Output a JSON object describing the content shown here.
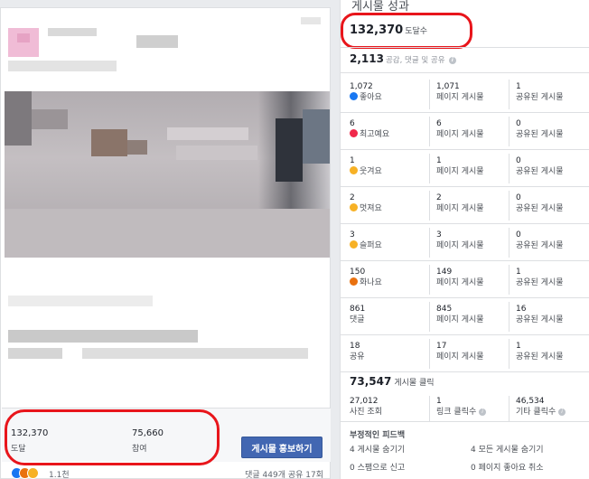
{
  "post": {
    "reach_value": "132,370",
    "reach_label": "도달",
    "engagement_value": "75,660",
    "engagement_label": "참여",
    "promote_button": "게시물 홍보하기",
    "reaction_count": "1.1천",
    "comments_shares": "댓글 449개  공유 17회"
  },
  "panel": {
    "title": "게시물 성과",
    "reach_value": "132,370",
    "reach_label": "도달수",
    "engagement_total": "2,113",
    "engagement_label": "공감, 댓글 및 공유",
    "rows": [
      {
        "icon": "like-emoji-icon",
        "emo": "like",
        "c1v": "1,072",
        "c1l": "좋아요",
        "c2v": "1,071",
        "c2l": "페이지 게시물",
        "c3v": "1",
        "c3l": "공유된 게시물"
      },
      {
        "icon": "love-emoji-icon",
        "emo": "love",
        "c1v": "6",
        "c1l": "최고예요",
        "c2v": "6",
        "c2l": "페이지 게시물",
        "c3v": "0",
        "c3l": "공유된 게시물"
      },
      {
        "icon": "haha-emoji-icon",
        "emo": "haha",
        "c1v": "1",
        "c1l": "웃겨요",
        "c2v": "1",
        "c2l": "페이지 게시물",
        "c3v": "0",
        "c3l": "공유된 게시물"
      },
      {
        "icon": "wow-emoji-icon",
        "emo": "wow",
        "c1v": "2",
        "c1l": "멋져요",
        "c2v": "2",
        "c2l": "페이지 게시물",
        "c3v": "0",
        "c3l": "공유된 게시물"
      },
      {
        "icon": "sad-emoji-icon",
        "emo": "sad",
        "c1v": "3",
        "c1l": "슬퍼요",
        "c2v": "3",
        "c2l": "페이지 게시물",
        "c3v": "0",
        "c3l": "공유된 게시물"
      },
      {
        "icon": "angry-emoji-icon",
        "emo": "angry",
        "c1v": "150",
        "c1l": "화나요",
        "c2v": "149",
        "c2l": "페이지 게시물",
        "c3v": "1",
        "c3l": "공유된 게시물"
      },
      {
        "icon": "",
        "emo": "",
        "c1v": "861",
        "c1l": "댓글",
        "c2v": "845",
        "c2l": "페이지 게시물",
        "c3v": "16",
        "c3l": "공유된 게시물"
      },
      {
        "icon": "",
        "emo": "",
        "c1v": "18",
        "c1l": "공유",
        "c2v": "17",
        "c2l": "페이지 게시물",
        "c3v": "1",
        "c3l": "공유된 게시물"
      }
    ],
    "post_clicks_value": "73,547",
    "post_clicks_label": "게시물 클릭",
    "photo_views_value": "27,012",
    "photo_views_label": "사진 조회",
    "link_clicks_value": "1",
    "link_clicks_label": "링크 클릭수",
    "other_clicks_value": "46,534",
    "other_clicks_label": "기타 클릭수",
    "negative_title": "부정적인 피드백",
    "neg_hide_post": "4 게시물 숨기기",
    "neg_hide_all": "4 모든 게시물 숨기기",
    "neg_report_spam": "0 스팸으로 신고",
    "neg_unlike_page": "0 페이지 좋아요 취소"
  },
  "colors": {
    "accent": "#4267b2",
    "highlight_oval": "#e8151b"
  }
}
